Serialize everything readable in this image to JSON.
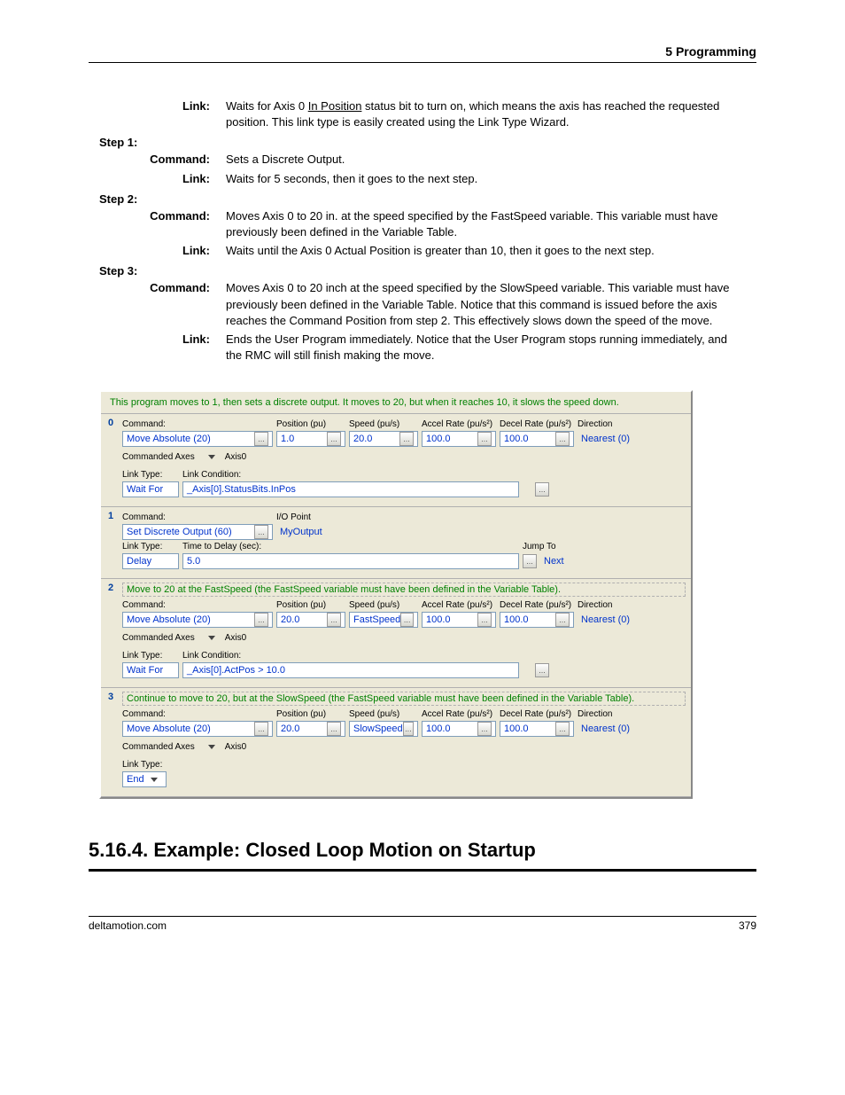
{
  "header": {
    "chapter": "5  Programming"
  },
  "intro": [
    {
      "label": "Link:",
      "text_pre": "Waits for Axis 0 ",
      "under": "In Position",
      "text_post": " status bit to turn on, which means the axis has reached the requested position. This link type is easily created using the Link Type Wizard."
    }
  ],
  "steps": [
    {
      "title": "Step 1:",
      "rows": [
        {
          "label": "Command:",
          "text": "Sets a Discrete Output."
        },
        {
          "label": "Link:",
          "text": "Waits for 5 seconds, then it goes to the next step."
        }
      ]
    },
    {
      "title": "Step 2:",
      "rows": [
        {
          "label": "Command:",
          "text": "Moves Axis 0 to 20 in. at the speed specified by the FastSpeed variable. This variable must have previously been defined in the Variable Table."
        },
        {
          "label": "Link:",
          "text": "Waits until the Axis 0 Actual Position is greater than 10, then it goes to the next step."
        }
      ]
    },
    {
      "title": "Step 3:",
      "rows": [
        {
          "label": "Command:",
          "text": "Moves Axis 0 to 20 inch at the speed specified by the SlowSpeed variable. This variable must have previously been defined in the Variable Table. Notice that this command is issued before the axis reaches the Command Position from step 2. This effectively slows down the speed of the move."
        },
        {
          "label": "Link:",
          "text": "Ends the User Program immediately. Notice that the User Program stops running immediately, and  the RMC will still finish making the move."
        }
      ]
    }
  ],
  "shot": {
    "top": "This program moves to 1, then sets a discrete output. It moves to 20, but when it reaches 10, it slows the speed down.",
    "hdrs": {
      "command": "Command:",
      "pos": "Position (pu)",
      "speed": "Speed (pu/s)",
      "accel": "Accel Rate (pu/s²)",
      "decel": "Decel Rate (pu/s²)",
      "dir": "Direction",
      "linktype": "Link Type:",
      "linkcond": "Link Condition:",
      "timedelay": "Time to Delay (sec):",
      "jumpto": "Jump To",
      "io": "I/O Point",
      "cmdaxes": "Commanded Axes",
      "axis0": "Axis0"
    },
    "blocks": [
      {
        "num": "0",
        "cmd": {
          "name": "Move Absolute (20)",
          "pos": "1.0",
          "speed": "20.0",
          "accel": "100.0",
          "decel": "100.0",
          "dir": "Nearest (0)"
        },
        "showAxes": true,
        "link": {
          "type": "Wait For",
          "condLabel": "Link Condition:",
          "cond": "_Axis[0].StatusBits.InPos",
          "dotsAfter": true
        }
      },
      {
        "num": "1",
        "cmdSimple": {
          "name": "Set Discrete Output (60)",
          "ioLabel": "I/O Point",
          "io": "MyOutput"
        },
        "linkDelay": {
          "type": "Delay",
          "label": "Time to Delay (sec):",
          "val": "5.0",
          "jlabel": "Jump To",
          "jump": "Next"
        }
      },
      {
        "num": "2",
        "note": "Move to 20 at the FastSpeed (the FastSpeed variable must have been defined in the Variable Table).",
        "cmd": {
          "name": "Move Absolute (20)",
          "pos": "20.0",
          "speed": "FastSpeed",
          "accel": "100.0",
          "decel": "100.0",
          "dir": "Nearest (0)"
        },
        "showAxes": true,
        "link": {
          "type": "Wait For",
          "condLabel": "Link Condition:",
          "cond": "_Axis[0].ActPos > 10.0",
          "dotsAfter": true
        }
      },
      {
        "num": "3",
        "note": "Continue to move to 20, but at the SlowSpeed (the FastSpeed variable must have been defined in the Variable Table).",
        "cmd": {
          "name": "Move Absolute (20)",
          "pos": "20.0",
          "speed": "SlowSpeed",
          "accel": "100.0",
          "decel": "100.0",
          "dir": "Nearest (0)"
        },
        "showAxes": true,
        "linkEnd": {
          "label": "Link Type:",
          "type": "End"
        }
      }
    ]
  },
  "section": "5.16.4. Example: Closed Loop Motion on Startup",
  "footer": {
    "left": "deltamotion.com",
    "right": "379"
  }
}
